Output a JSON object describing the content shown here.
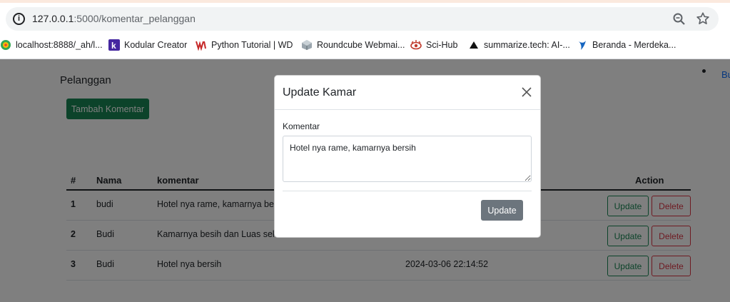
{
  "browser": {
    "url_host": "127.0.0.1",
    "url_path": ":5000/komentar_pelanggan",
    "bookmarks": [
      {
        "label": "localhost:8888/_ah/l...",
        "icon": "appengine-icon"
      },
      {
        "label": "Kodular Creator",
        "icon": "kodular-icon"
      },
      {
        "label": "Python Tutorial | WD",
        "icon": "python-tutorial-icon"
      },
      {
        "label": "Roundcube Webmai...",
        "icon": "roundcube-icon"
      },
      {
        "label": "Sci-Hub",
        "icon": "scihub-icon"
      },
      {
        "label": "summarize.tech: AI-...",
        "icon": "summarize-icon"
      },
      {
        "label": "Beranda - Merdeka...",
        "icon": "merdeka-icon"
      }
    ]
  },
  "page": {
    "title": "Pelanggan",
    "add_button": "Tambah Komentar",
    "nav_link": "Bu"
  },
  "table": {
    "headers": {
      "num": "#",
      "name": "Nama",
      "komentar": "komentar",
      "action": "Action"
    },
    "rows": [
      {
        "num": "1",
        "name": "budi",
        "komentar": "Hotel nya rame, kamarnya bersih",
        "date": "",
        "update": "Update",
        "delete": "Delete"
      },
      {
        "num": "2",
        "name": "Budi",
        "komentar": "Kamarnya besih dan Luas sekali",
        "date": "",
        "update": "Update",
        "delete": "Delete"
      },
      {
        "num": "3",
        "name": "Budi",
        "komentar": "Hotel nya bersih",
        "date": "2024-03-06 22:14:52",
        "update": "Update",
        "delete": "Delete"
      }
    ]
  },
  "modal": {
    "title": "Update Kamar",
    "field_label": "Komentar",
    "field_value": "Hotel nya rame, kamarnya bersih",
    "submit": "Update"
  },
  "colors": {
    "success": "#198754",
    "danger": "#dc3545",
    "secondary": "#6c757d",
    "link": "#0d6efd"
  }
}
